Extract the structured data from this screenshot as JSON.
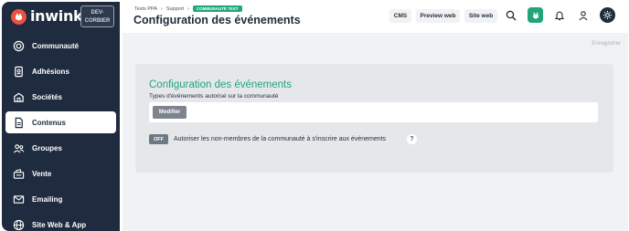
{
  "app": {
    "logo_text": "inwink",
    "env_badge_line1": "DEV-",
    "env_badge_line2": "CORBIER"
  },
  "sidebar": {
    "items": [
      {
        "label": "Communauté",
        "icon": "target-icon",
        "active": false
      },
      {
        "label": "Adhésions",
        "icon": "member-card-icon",
        "active": false
      },
      {
        "label": "Sociétés",
        "icon": "building-icon",
        "active": false
      },
      {
        "label": "Contenus",
        "icon": "document-icon",
        "active": true
      },
      {
        "label": "Groupes",
        "icon": "group-icon",
        "active": false
      },
      {
        "label": "Vente",
        "icon": "sales-icon",
        "active": false
      },
      {
        "label": "Emailing",
        "icon": "envelope-icon",
        "active": false
      },
      {
        "label": "Site Web & App",
        "icon": "globe-icon",
        "active": false
      }
    ]
  },
  "header": {
    "breadcrumb": [
      "Tests PPA",
      "Support"
    ],
    "breadcrumb_badge": "COMMUNAUTÉ TEST",
    "title": "Configuration des événements",
    "buttons": {
      "cms": "CMS",
      "preview": "Preview web",
      "site": "Site web"
    }
  },
  "main": {
    "save_label": "Enregistrer",
    "card": {
      "title": "Configuration des événements",
      "subtitle": "Types d'événements autorisé sur la communauté",
      "modify_button": "Modifier",
      "toggle_state": "OFF",
      "toggle_label": "Autoriser les non-membres de la communauté à s'inscrire aux événements",
      "help": "?"
    }
  },
  "colors": {
    "sidebar_bg": "#1f2b3f",
    "accent_green": "#1fa67a",
    "logo_red": "#e9533f"
  }
}
